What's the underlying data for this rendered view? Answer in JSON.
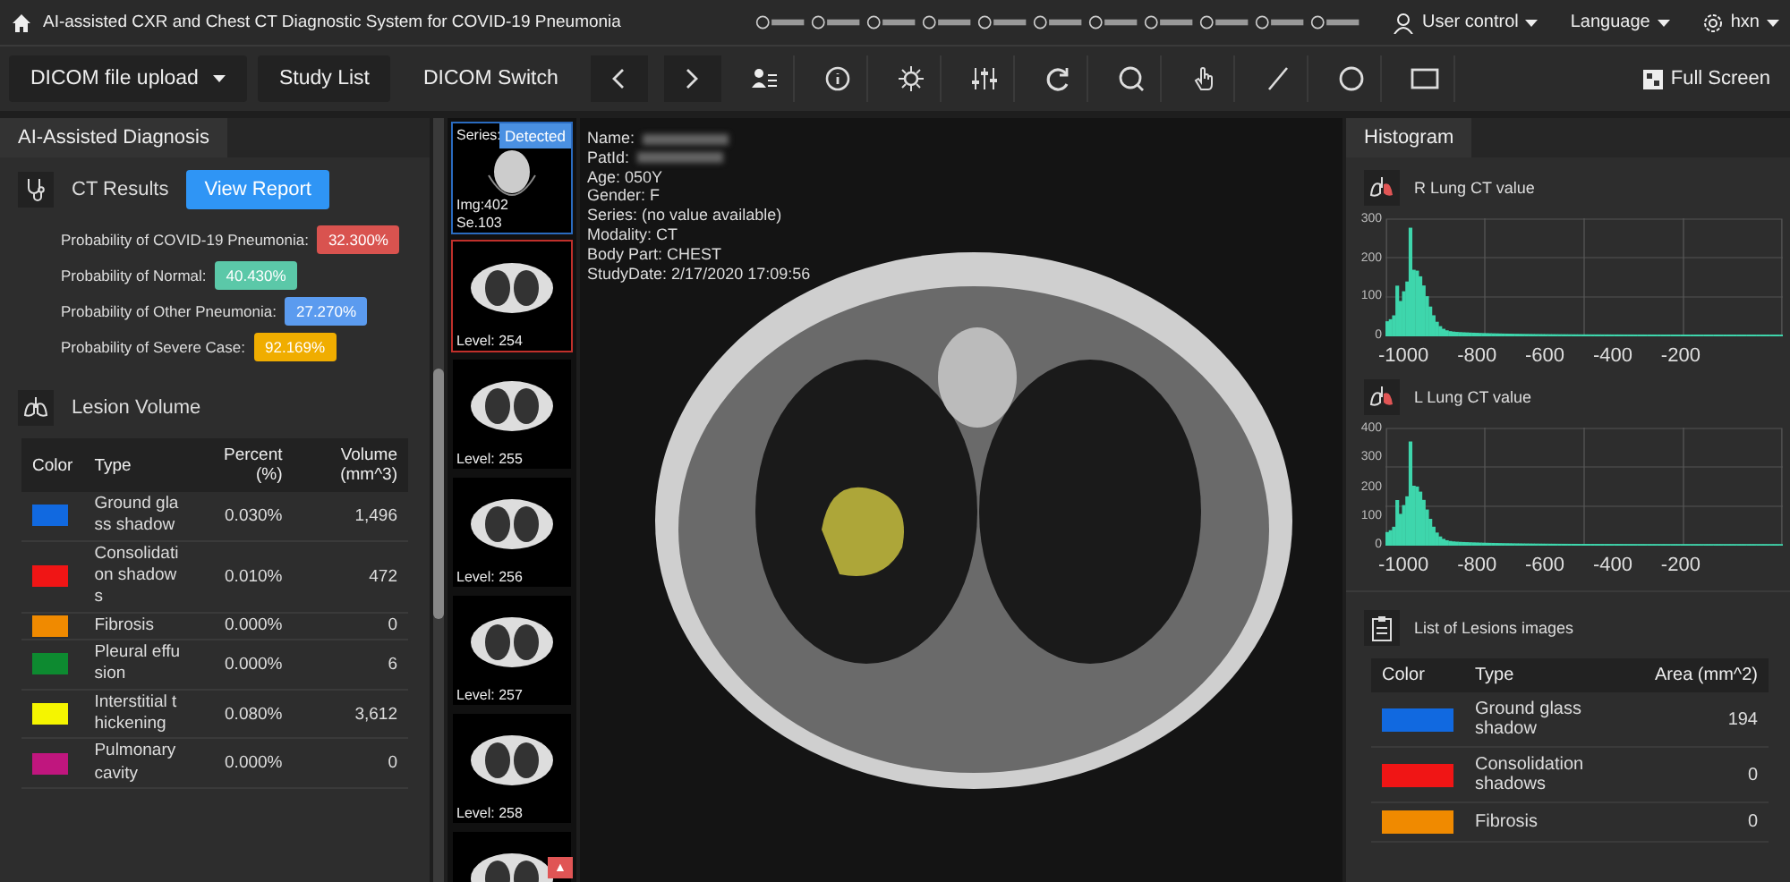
{
  "header": {
    "title": "AI-assisted CXR and Chest CT Diagnostic System for COVID-19 Pneumonia",
    "menus": [
      {
        "label": "User control",
        "kind": "user"
      },
      {
        "label": "Language",
        "kind": "plain"
      },
      {
        "label": "hxn",
        "kind": "settings"
      }
    ]
  },
  "toolbar": {
    "upload": "DICOM file upload",
    "study_list": "Study List",
    "dicom_switch": "DICOM Switch",
    "full_screen": "Full Screen"
  },
  "left_panel": {
    "tab": "AI-Assisted Diagnosis",
    "ct_results": {
      "label": "CT Results",
      "button": "View Report"
    },
    "probabilities": [
      {
        "label": "Probability of COVID-19 Pneumonia:",
        "value": "32.300%",
        "color": "#d9534f"
      },
      {
        "label": "Probability of Normal:",
        "value": "40.430%",
        "color": "#5bc8a8"
      },
      {
        "label": "Probability of Other Pneumonia:",
        "value": "27.270%",
        "color": "#5b9bef"
      },
      {
        "label": "Probability of Severe Case:",
        "value": "92.169%",
        "color": "#f0ad00"
      }
    ],
    "lesion_volume": {
      "label": "Lesion Volume",
      "columns": [
        "Color",
        "Type",
        "Percent (%)",
        "Volume (mm^3)"
      ],
      "rows": [
        {
          "color": "#1169e0",
          "type": "Ground glass shadow",
          "percent": "0.030%",
          "volume": "1,496"
        },
        {
          "color": "#f01515",
          "type": "Consolidation shadows",
          "percent": "0.010%",
          "volume": "472"
        },
        {
          "color": "#f08a00",
          "type": "Fibrosis",
          "percent": "0.000%",
          "volume": "0"
        },
        {
          "color": "#0d8a30",
          "type": "Pleural effusion",
          "percent": "0.000%",
          "volume": "6"
        },
        {
          "color": "#f5f500",
          "type": "Interstitial thickening",
          "percent": "0.080%",
          "volume": "3,612"
        },
        {
          "color": "#c0167e",
          "type": "Pulmonary cavity",
          "percent": "0.000%",
          "volume": "0"
        }
      ]
    }
  },
  "thumbnails": {
    "series": {
      "label": "Series:",
      "badge": "Detected",
      "image": "Img:402",
      "number": "Se.103",
      "selected": true
    },
    "items": [
      {
        "label": "Level: 254",
        "selected": true
      },
      {
        "label": "Level: 255",
        "selected": false
      },
      {
        "label": "Level: 256",
        "selected": false
      },
      {
        "label": "Level: 257",
        "selected": false
      },
      {
        "label": "Level: 258",
        "selected": false
      },
      {
        "selected": false
      }
    ],
    "scroll_button": "▲"
  },
  "viewer": {
    "metadata": [
      {
        "label": "Name:",
        "kind": "redacted"
      },
      {
        "label": "PatId:",
        "kind": "redacted"
      },
      {
        "label": "Age:",
        "value": "050Y",
        "kind": "text"
      },
      {
        "label": "Gender:",
        "value": "F",
        "kind": "text"
      },
      {
        "label": "Series:",
        "value": "(no value available)",
        "kind": "text"
      },
      {
        "label": "Modality:",
        "value": "CT",
        "kind": "text"
      },
      {
        "label": "Body Part:",
        "value": "CHEST",
        "kind": "text"
      },
      {
        "label": "StudyDate:",
        "value": "2/17/2020 17:09:56",
        "kind": "text"
      }
    ]
  },
  "right_panel": {
    "tab": "Histogram",
    "histograms": [
      {
        "title": "R Lung CT value",
        "y_ticks": [
          "300",
          "200",
          "100",
          "0"
        ],
        "x_ticks": [
          "-1000",
          "-800",
          "-600",
          "-400",
          "-200"
        ]
      },
      {
        "title": "L Lung CT value",
        "y_ticks": [
          "400",
          "300",
          "200",
          "100",
          "0"
        ],
        "x_ticks": [
          "-1000",
          "-800",
          "-600",
          "-400",
          "-200"
        ]
      }
    ],
    "lesions_list": {
      "title": "List of Lesions images",
      "columns": [
        "Color",
        "Type",
        "Area (mm^2)"
      ],
      "rows": [
        {
          "color": "#1169e0",
          "type": "Ground glass shadow",
          "area": "194"
        },
        {
          "color": "#f01515",
          "type": "Consolidation shadows",
          "area": "0"
        },
        {
          "color": "#f08a00",
          "type": "Fibrosis",
          "area": "0"
        }
      ]
    }
  }
}
